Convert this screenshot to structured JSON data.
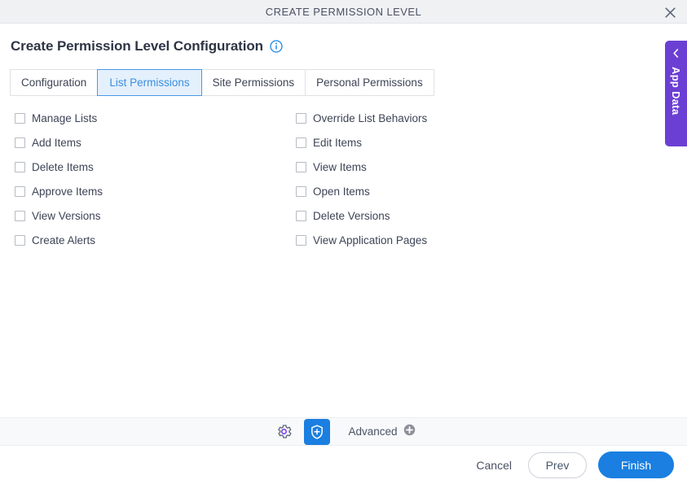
{
  "window": {
    "title": "CREATE PERMISSION LEVEL",
    "close_icon": "close-icon"
  },
  "header": {
    "title": "Create Permission Level Configuration",
    "info_icon": "info-icon"
  },
  "tabs": [
    {
      "label": "Configuration",
      "active": false
    },
    {
      "label": "List Permissions",
      "active": true
    },
    {
      "label": "Site Permissions",
      "active": false
    },
    {
      "label": "Personal Permissions",
      "active": false
    }
  ],
  "permissions": {
    "left_column": [
      {
        "label": "Manage Lists",
        "checked": false
      },
      {
        "label": "Add Items",
        "checked": false
      },
      {
        "label": "Delete Items",
        "checked": false
      },
      {
        "label": "Approve Items",
        "checked": false
      },
      {
        "label": "View Versions",
        "checked": false
      },
      {
        "label": "Create Alerts",
        "checked": false
      }
    ],
    "right_column": [
      {
        "label": "Override List Behaviors",
        "checked": false
      },
      {
        "label": "Edit Items",
        "checked": false
      },
      {
        "label": "View Items",
        "checked": false
      },
      {
        "label": "Open Items",
        "checked": false
      },
      {
        "label": "Delete Versions",
        "checked": false
      },
      {
        "label": "View Application Pages",
        "checked": false
      }
    ]
  },
  "toolbar": {
    "settings_icon": "gear-icon",
    "security_icon": "shield-plus-icon",
    "advanced_label": "Advanced",
    "advanced_add_icon": "plus-circle-icon"
  },
  "footer": {
    "cancel_label": "Cancel",
    "prev_label": "Prev",
    "finish_label": "Finish"
  },
  "side_panel": {
    "label": "App Data",
    "chevron_icon": "chevron-left-icon"
  },
  "colors": {
    "accent_blue": "#1a7fe0",
    "tab_active_text": "#3b8ede",
    "tab_active_bg": "#e4f0fc",
    "purple": "#6c3fd4",
    "titlebar_bg": "#f0f1f3",
    "toolbar_bg": "#f8f9fb"
  }
}
